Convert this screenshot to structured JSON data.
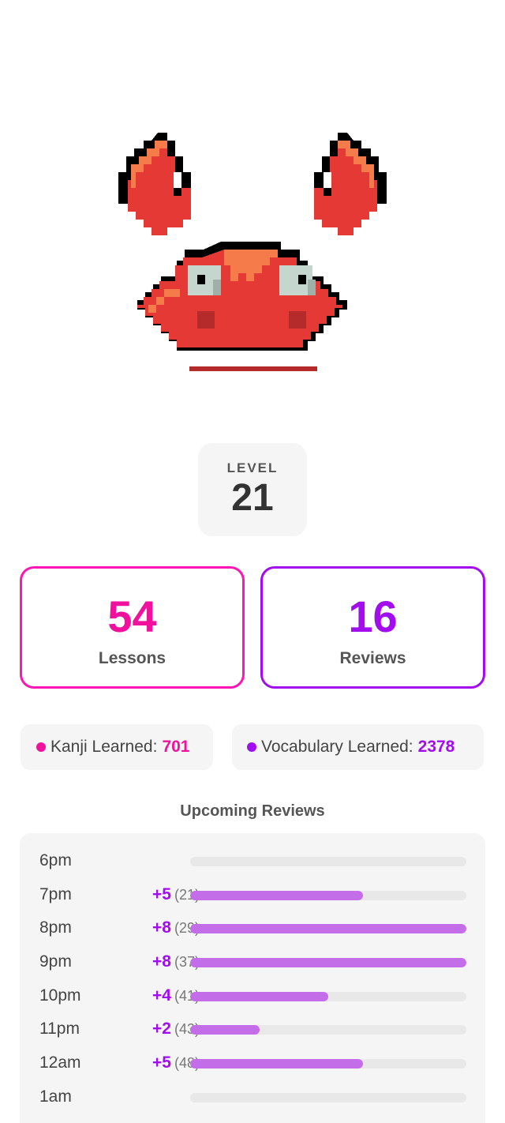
{
  "mascot": {
    "icon": "pixel-crab-icon",
    "colors": {
      "body": "#e53935",
      "highlight": "#f57c4a",
      "outline": "#000000",
      "eyes": "#c5d6cf"
    }
  },
  "level": {
    "label": "LEVEL",
    "value": "21"
  },
  "stats": {
    "lessons": {
      "count": "54",
      "label": "Lessons",
      "color": "#f0129d"
    },
    "reviews": {
      "count": "16",
      "label": "Reviews",
      "color": "#a20df0"
    }
  },
  "learned": {
    "kanji": {
      "label": "Kanji Learned:",
      "value": "701"
    },
    "vocabulary": {
      "label": "Vocabulary Learned:",
      "value": "2378"
    }
  },
  "upcoming": {
    "title": "Upcoming Reviews",
    "rows": [
      {
        "time": "6pm",
        "plus": "",
        "total": "",
        "dash": "-",
        "fill": 0
      },
      {
        "time": "7pm",
        "plus": "+5",
        "total": "(21)",
        "dash": "",
        "fill": 0.625
      },
      {
        "time": "8pm",
        "plus": "+8",
        "total": "(29)",
        "dash": "",
        "fill": 1.0
      },
      {
        "time": "9pm",
        "plus": "+8",
        "total": "(37)",
        "dash": "",
        "fill": 1.0
      },
      {
        "time": "10pm",
        "plus": "+4",
        "total": "(41)",
        "dash": "",
        "fill": 0.5
      },
      {
        "time": "11pm",
        "plus": "+2",
        "total": "(43)",
        "dash": "",
        "fill": 0.25
      },
      {
        "time": "12am",
        "plus": "+5",
        "total": "(48)",
        "dash": "",
        "fill": 0.625
      },
      {
        "time": "1am",
        "plus": "",
        "total": "",
        "dash": "-",
        "fill": 0
      }
    ]
  }
}
